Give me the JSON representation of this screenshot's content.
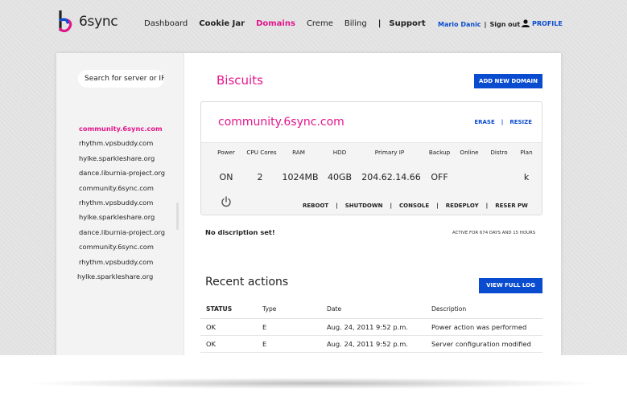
{
  "brand": {
    "name": "6sync",
    "accent": "#e2168b",
    "primary": "#0a4ccf"
  },
  "nav": {
    "items": [
      "Dashboard",
      "Cookie Jar",
      "Domains",
      "Creme",
      "Biling"
    ],
    "separator": "|",
    "support": "Support",
    "active": "Domains"
  },
  "user": {
    "name": "Mario Danic",
    "separator": "|",
    "signout": "Sign out",
    "profile": "PROFILE",
    "profile_icon": "user-icon"
  },
  "sidebar": {
    "search_placeholder": "Search for server or IP",
    "servers": [
      "community.6sync.com",
      "rhythm.vpsbuddy.com",
      "hylke.sparkleshare.org",
      "dance.liburnia-project.org",
      "community.6sync.com",
      "rhythm.vpsbuddy.com",
      "hylke.sparkleshare.org",
      "dance.liburnia-project.org",
      "community.6sync.com",
      "rhythm.vpsbuddy.com",
      "hylke.sparkleshare.org"
    ]
  },
  "main": {
    "title": "Biscuits",
    "add_button": "ADD NEW DOMAIN",
    "server": {
      "name": "community.6sync.com",
      "erase": "ERASE",
      "separator": "|",
      "resize": "RESIZE",
      "specs": {
        "headers": [
          "Power",
          "CPU Cores",
          "RAM",
          "HDD",
          "Primary IP",
          "Backup",
          "Online",
          "Distro",
          "Plan"
        ],
        "values": [
          "ON",
          "2",
          "1024MB",
          "40GB",
          "204.62.14.66",
          "OFF",
          "",
          "",
          "k"
        ]
      },
      "power_icon": "power-icon",
      "controls": [
        "REBOOT",
        "SHUTDOWN",
        "CONSOLE",
        "REDEPLOY",
        "RESER PW"
      ],
      "control_separator": "|"
    },
    "description": "No discription set!",
    "active_for": "ACTIVE FOR 674 DAYS AND 15 HOURS",
    "recent": {
      "title": "Recent actions",
      "log_button": "VIEW FULL LOG",
      "columns": [
        "STATUS",
        "Type",
        "Date",
        "Description"
      ],
      "rows": [
        [
          "OK",
          "E",
          "Aug. 24, 2011 9:52 p.m.",
          "Power action was performed"
        ],
        [
          "OK",
          "E",
          "Aug. 24, 2011 9:52 p.m.",
          "Server configuration modified"
        ]
      ]
    }
  }
}
